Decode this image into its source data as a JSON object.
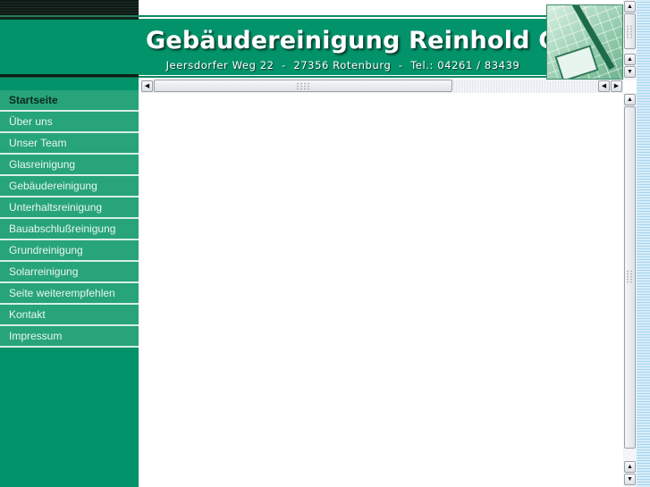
{
  "header": {
    "title": "Gebäudereinigung Reinhold GmbH",
    "address": "Jeersdorfer Weg 22  -  27356 Rotenburg  -  Tel.: 04261 / 83439",
    "photo": "cleaning-mop-photo"
  },
  "nav": {
    "active_index": 0,
    "items": [
      {
        "label": "Startseite"
      },
      {
        "label": "Über uns"
      },
      {
        "label": "Unser Team"
      },
      {
        "label": "Glasreinigung"
      },
      {
        "label": "Gebäudereinigung"
      },
      {
        "label": "Unterhaltsreinigung"
      },
      {
        "label": "Bauabschlußreinigung"
      },
      {
        "label": "Grundreinigung"
      },
      {
        "label": "Solarreinigung"
      },
      {
        "label": "Seite weiterempfehlen"
      },
      {
        "label": "Kontakt"
      },
      {
        "label": "Impressum"
      }
    ]
  },
  "scrollbars": {
    "arrow_up": "▲",
    "arrow_down": "▼",
    "arrow_left": "◀",
    "arrow_right": "▶"
  },
  "colors": {
    "brand_green": "#02936b",
    "nav_green": "#27a47a",
    "nav_separator": "#d7efe4"
  }
}
